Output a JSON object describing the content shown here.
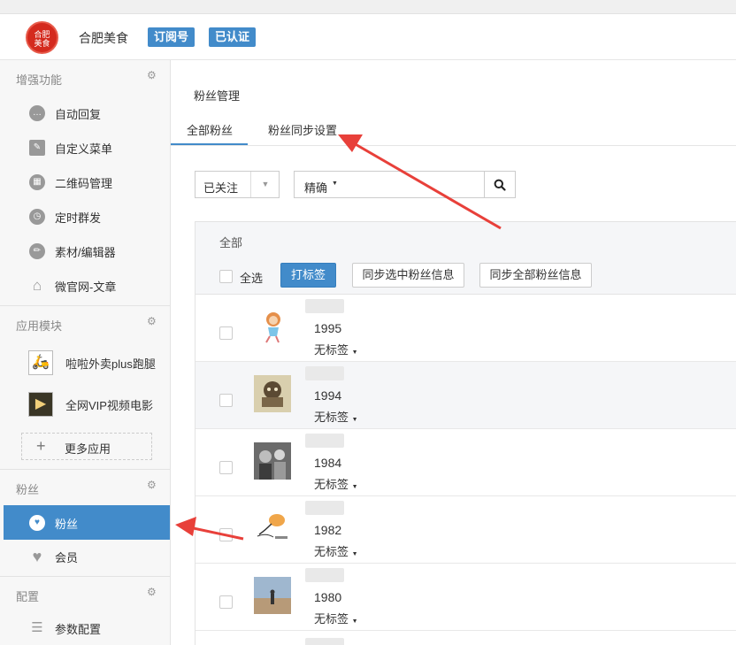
{
  "header": {
    "logo_text": "合肥\n美食",
    "account_name": "合肥美食",
    "badge_subscription": "订阅号",
    "badge_verified": "已认证"
  },
  "sidebar": {
    "sections": {
      "enhance": "增强功能",
      "apps": "应用模块",
      "fans": "粉丝",
      "config": "配置"
    },
    "enhance_items": [
      "自动回复",
      "自定义菜单",
      "二维码管理",
      "定时群发",
      "素材/编辑器",
      "微官网-文章"
    ],
    "app_items": [
      "啦啦外卖plus跑腿",
      "全网VIP视频电影"
    ],
    "more_apps": "更多应用",
    "fans_items": [
      "粉丝",
      "会员"
    ],
    "config_items": [
      "参数配置"
    ]
  },
  "main": {
    "page_title": "粉丝管理",
    "tabs": [
      "全部粉丝",
      "粉丝同步设置"
    ],
    "filter_value": "已关注",
    "mode_value": "精确",
    "search_placeholder": "",
    "panel_title": "全部",
    "select_all": "全选",
    "btn_tag": "打标签",
    "btn_sync_selected": "同步选中粉丝信息",
    "btn_sync_all": "同步全部粉丝信息",
    "rows": [
      {
        "year": "1995",
        "tag": "无标签"
      },
      {
        "year": "1994",
        "tag": "无标签"
      },
      {
        "year": "1984",
        "tag": "无标签"
      },
      {
        "year": "1982",
        "tag": "无标签"
      },
      {
        "year": "1980",
        "tag": "无标签"
      }
    ]
  },
  "colors": {
    "accent": "#428bca",
    "annotation_arrow": "#e8403a"
  }
}
